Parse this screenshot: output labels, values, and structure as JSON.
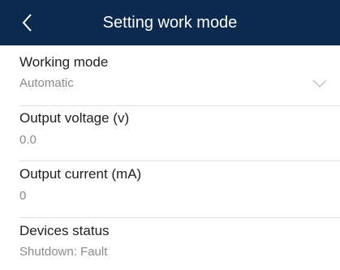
{
  "header": {
    "title": "Setting work mode",
    "back_icon": "chevron-left-icon",
    "background": "#0c2a4f"
  },
  "fields": {
    "working_mode": {
      "label": "Working mode",
      "value": "Automatic",
      "icon": "chevron-down-icon"
    },
    "output_voltage": {
      "label": "Output voltage (v)",
      "value": "0.0"
    },
    "output_current": {
      "label": "Output current (mA)",
      "value": "0"
    },
    "devices_status": {
      "label": "Devices status",
      "value": "Shutdown: Fault"
    }
  }
}
